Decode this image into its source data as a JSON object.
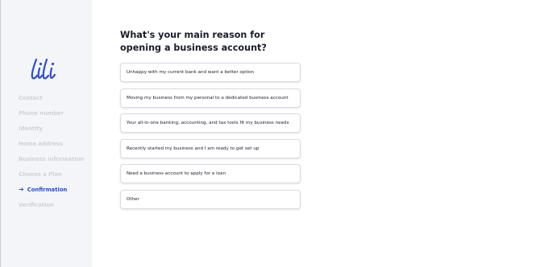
{
  "brand": {
    "logo_text": "lili",
    "accent_color": "#2b4bd9"
  },
  "sidebar": {
    "steps": [
      {
        "label": "Contact",
        "state": "done"
      },
      {
        "label": "Phone number",
        "state": "done"
      },
      {
        "label": "Identity",
        "state": "done"
      },
      {
        "label": "Home address",
        "state": "done"
      },
      {
        "label": "Business information",
        "state": "done"
      },
      {
        "label": "Choose a Plan",
        "state": "done"
      },
      {
        "label": "Confirmation",
        "state": "active",
        "icon": "arrow-right-icon"
      },
      {
        "label": "Verification",
        "state": "pending"
      }
    ]
  },
  "main": {
    "title": "What's your main reason for opening a business account?",
    "options": [
      "Unhappy with my current bank and want a better option",
      "Moving my business from my personal to a dedicated business account",
      "Your all-in-one banking, accounting, and tax tools fit my business needs",
      "Recently started my business and I am ready to get set up",
      "Need a business account to apply for a loan",
      "Other"
    ]
  }
}
